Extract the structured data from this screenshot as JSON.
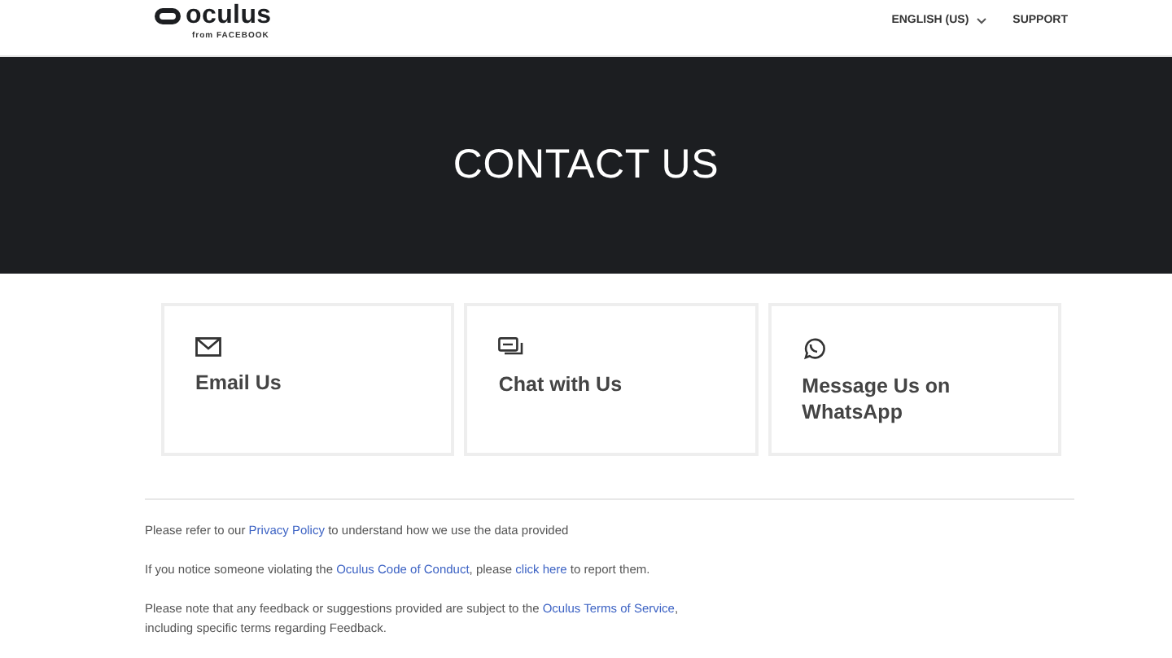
{
  "header": {
    "logo": "oculus",
    "logo_sub": "from FACEBOOK",
    "language": "ENGLISH (US)",
    "support": "SUPPORT"
  },
  "banner": {
    "title": "CONTACT US"
  },
  "cards": [
    {
      "kind": "email",
      "label": "Email Us"
    },
    {
      "kind": "chat",
      "label": "Chat with Us"
    },
    {
      "kind": "whatsapp",
      "label": "Message Us on WhatsApp"
    }
  ],
  "notes": [
    [
      {
        "kind": "text",
        "text": "Please refer to our "
      },
      {
        "kind": "link",
        "text": "Privacy Policy"
      },
      {
        "kind": "text",
        "text": " to understand how we use the data provided"
      }
    ],
    [
      {
        "kind": "text",
        "text": "If you notice someone violating the "
      },
      {
        "kind": "link",
        "text": "Oculus Code of Conduct"
      },
      {
        "kind": "text",
        "text": ", please "
      },
      {
        "kind": "link",
        "text": "click here"
      },
      {
        "kind": "text",
        "text": " to report them."
      }
    ],
    [
      {
        "kind": "text",
        "text": "Please note that any feedback or suggestions provided are subject to the "
      },
      {
        "kind": "link",
        "text": "Oculus Terms of "
      },
      {
        "kind": "link",
        "text": "Service"
      },
      {
        "kind": "text",
        "text": ", including specific terms regarding Feedback."
      }
    ]
  ]
}
